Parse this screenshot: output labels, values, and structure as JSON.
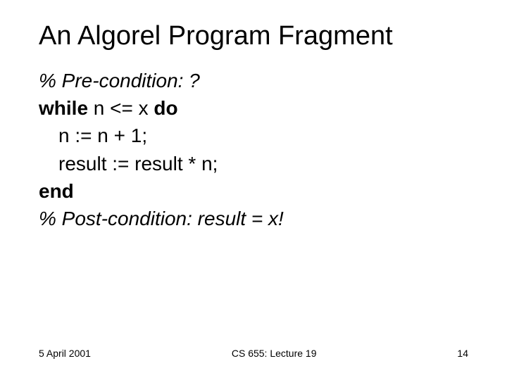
{
  "title": "An Algorel Program Fragment",
  "lines": {
    "pre": "% Pre-condition: ?",
    "while_kw": "while",
    "while_cond": " n <= x ",
    "do_kw": "do",
    "stmt1": "n := n + 1;",
    "stmt2": "result := result * n;",
    "end_kw": "end",
    "post": "% Post-condition: result = x!"
  },
  "footer": {
    "date": "5 April 2001",
    "course": "CS 655: Lecture 19",
    "page": "14"
  }
}
